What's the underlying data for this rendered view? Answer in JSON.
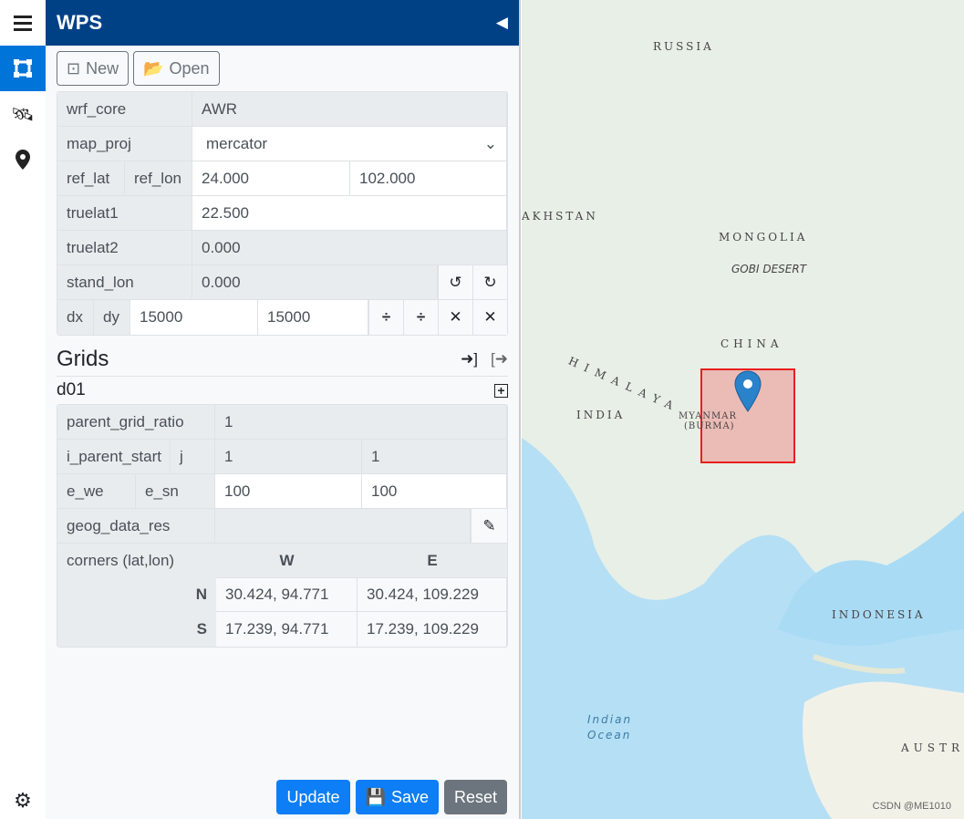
{
  "sidebar": {
    "items": [
      {
        "icon": "menu-icon"
      },
      {
        "icon": "vector-square-icon",
        "active": true
      },
      {
        "icon": "satellite-icon"
      },
      {
        "icon": "map-marker-icon"
      }
    ],
    "bottom_icon": "gear-icon"
  },
  "header": {
    "title": "WPS"
  },
  "toolbar": {
    "new_label": "New",
    "open_label": "Open"
  },
  "domain": {
    "wrf_core": {
      "label": "wrf_core",
      "value": "AWR"
    },
    "map_proj": {
      "label": "map_proj",
      "value": "mercator"
    },
    "ref": {
      "lat_label": "ref_lat",
      "lon_label": "ref_lon",
      "lat": "24.000",
      "lon": "102.000"
    },
    "truelat1": {
      "label": "truelat1",
      "value": "22.500"
    },
    "truelat2": {
      "label": "truelat2",
      "value": "0.000"
    },
    "stand_lon": {
      "label": "stand_lon",
      "value": "0.000"
    },
    "dxdy": {
      "dx_label": "dx",
      "dy_label": "dy",
      "dx": "15000",
      "dy": "15000"
    }
  },
  "grids": {
    "title": "Grids",
    "domain_name": "d01",
    "parent_grid_ratio": {
      "label": "parent_grid_ratio",
      "value": "1"
    },
    "parent_start": {
      "i_label": "i_parent_start",
      "j_label": "j",
      "i": "1",
      "j": "1"
    },
    "size": {
      "we_label": "e_we",
      "sn_label": "e_sn",
      "we": "100",
      "sn": "100"
    },
    "geog": {
      "label": "geog_data_res",
      "value": ""
    },
    "corners": {
      "label": "corners (lat,lon)",
      "w": "W",
      "e": "E",
      "n": "N",
      "s": "S",
      "nw": "30.424, 94.771",
      "ne": "30.424, 109.229",
      "sw": "17.239, 94.771",
      "se": "17.239, 109.229"
    }
  },
  "footer": {
    "update": "Update",
    "save": "Save",
    "reset": "Reset"
  },
  "map": {
    "labels": {
      "russia": "RUSSIA",
      "kazakhstan": "AKHSTAN",
      "mongolia": "MONGOLIA",
      "gobi": "GOBI DESERT",
      "china": "CHINA",
      "himalaya": "HIMALAYA",
      "india": "INDIA",
      "myanmar": "MYANMAR",
      "burma": "(BURMA)",
      "indonesia": "INDONESIA",
      "indian": "Indian",
      "ocean": "Ocean",
      "australia": "AUSTR"
    },
    "watermark": "CSDN @ME1010"
  }
}
